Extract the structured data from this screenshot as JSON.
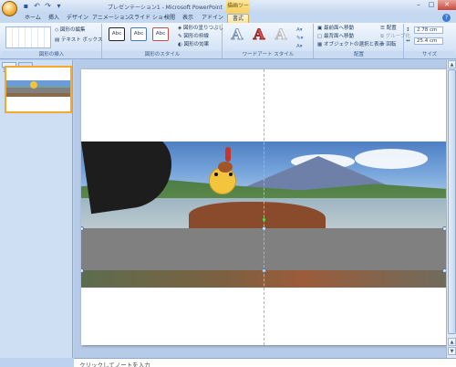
{
  "window": {
    "title": "プレゼンテーション1 - Microsoft PowerPoint",
    "contextual_tab_group": "描画ツール",
    "buttons": [
      "minimize",
      "maximize",
      "close"
    ]
  },
  "quick_access": [
    {
      "icon": "save-icon",
      "glyph": "▪"
    },
    {
      "icon": "undo-icon",
      "glyph": "↶"
    },
    {
      "icon": "redo-icon",
      "glyph": "↷"
    },
    {
      "icon": "customize-icon",
      "glyph": "▾"
    }
  ],
  "tabs": [
    {
      "label": "ホーム",
      "active": false
    },
    {
      "label": "挿入",
      "active": false
    },
    {
      "label": "デザイン",
      "active": false
    },
    {
      "label": "アニメーション",
      "active": false
    },
    {
      "label": "スライド ショー",
      "active": false
    },
    {
      "label": "校閲",
      "active": false
    },
    {
      "label": "表示",
      "active": false
    },
    {
      "label": "アドイン",
      "active": false
    },
    {
      "label": "書式",
      "active": true
    }
  ],
  "ribbon": {
    "insert_shapes": {
      "label": "図形の挿入",
      "edit_shape": "図形の編集",
      "text_box": "テキスト ボックス"
    },
    "shape_styles": {
      "label": "図形のスタイル",
      "swatches": [
        "Abc",
        "Abc",
        "Abc"
      ],
      "fill": "図形の塗りつぶし",
      "outline": "図形の枠線",
      "effects": "図形の効果"
    },
    "wordart_styles": {
      "label": "ワードアート スタイル",
      "glyphs": [
        "A",
        "A",
        "A"
      ]
    },
    "arrange": {
      "label": "配置",
      "bring_front": "最前面へ移動",
      "send_back": "最背面へ移動",
      "selection_pane": "オブジェクトの選択と表示",
      "align": "配置",
      "group": "グループ化",
      "rotate": "回転"
    },
    "size": {
      "label": "サイズ",
      "height": "2.78 cm",
      "width": "25.4 cm"
    }
  },
  "left_pane": {
    "slide_number": "1"
  },
  "notes": {
    "placeholder": "クリックしてノートを入力"
  }
}
